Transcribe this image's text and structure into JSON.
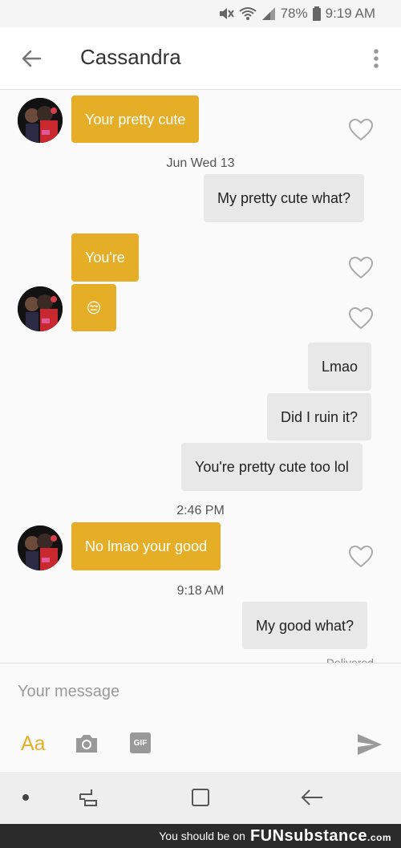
{
  "status_bar": {
    "battery": "78%",
    "time": "9:19 AM"
  },
  "header": {
    "contact_name": "Cassandra"
  },
  "messages": {
    "m1": "Your pretty cute",
    "t1": "Jun Wed 13",
    "m2": "My pretty cute what?",
    "m3": "You're",
    "m4": "😒",
    "m5": "Lmao",
    "m6": "Did I ruin it?",
    "m7": "You're pretty cute too lol",
    "t2": "2:46 PM",
    "m8": "No lmao your good",
    "t3": "9:18 AM",
    "m9": "My good what?",
    "delivered": "Delivered"
  },
  "composer": {
    "placeholder": "Your message",
    "aa_label": "Aa",
    "gif_label": "GIF"
  },
  "watermark": {
    "prefix": "You should be on",
    "brand_fun": "FUN",
    "brand_rest": "substance",
    "brand_suffix": ".com"
  },
  "colors": {
    "incoming_bubble": "#e5ae26",
    "outgoing_bubble": "#e8e8e8",
    "accent": "#e5ae26"
  },
  "icons": [
    "mute-icon",
    "wifi-icon",
    "signal-icon",
    "back-arrow-icon",
    "more-vert-icon",
    "heart-icon",
    "camera-icon",
    "gif-icon",
    "send-icon",
    "recent-apps-icon",
    "home-icon",
    "nav-back-icon"
  ]
}
